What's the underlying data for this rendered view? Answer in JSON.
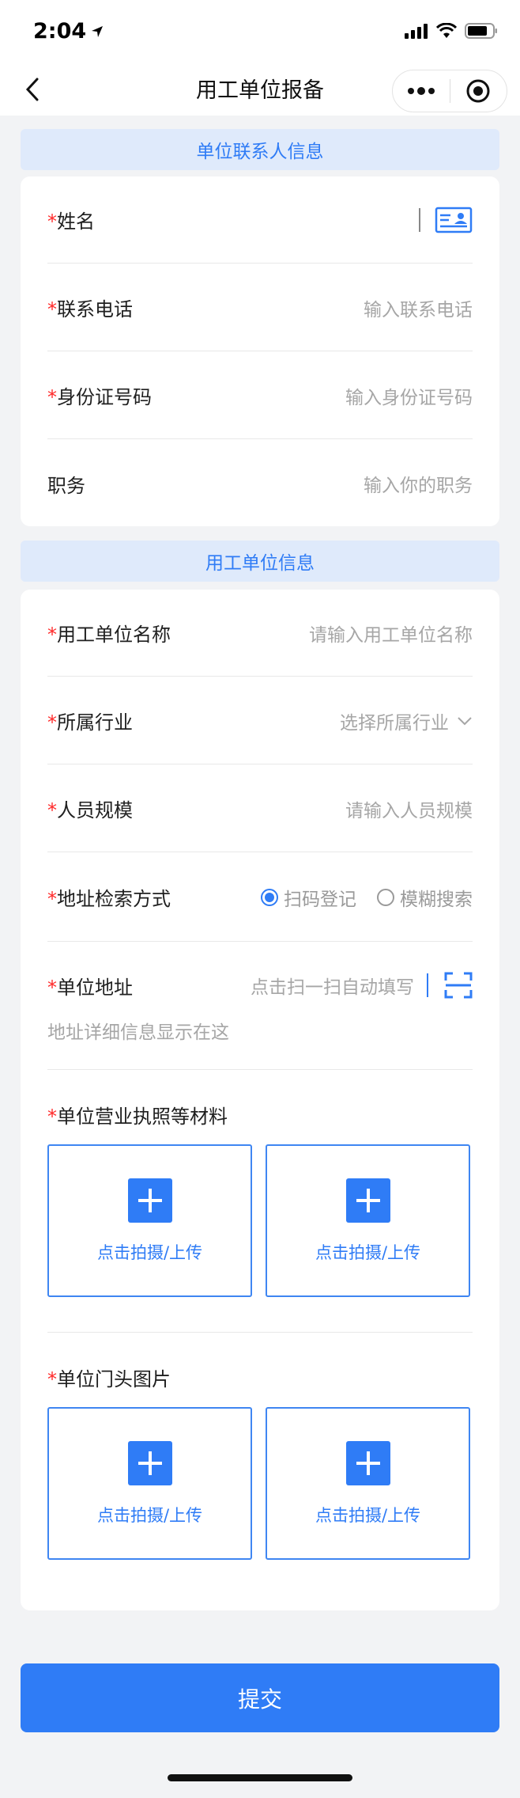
{
  "status_bar": {
    "time": "2:04"
  },
  "nav": {
    "title": "用工单位报备"
  },
  "contact_section": {
    "header": "单位联系人信息",
    "fields": [
      {
        "label": "姓名",
        "required": true,
        "placeholder": ""
      },
      {
        "label": "联系电话",
        "required": true,
        "placeholder": "输入联系电话"
      },
      {
        "label": "身份证号码",
        "required": true,
        "placeholder": "输入身份证号码"
      },
      {
        "label": "职务",
        "required": false,
        "placeholder": "输入你的职务"
      }
    ]
  },
  "unit_section": {
    "header": "用工单位信息",
    "name": {
      "label": "用工单位名称",
      "placeholder": "请输入用工单位名称"
    },
    "industry": {
      "label": "所属行业",
      "placeholder": "选择所属行业"
    },
    "scale": {
      "label": "人员规模",
      "placeholder": "请输入人员规模"
    },
    "search_mode": {
      "label": "地址检索方式",
      "options": [
        "扫码登记",
        "模糊搜索"
      ],
      "selected": "扫码登记"
    },
    "address": {
      "label": "单位地址",
      "placeholder": "点击扫一扫自动填写",
      "detail_placeholder": "地址详细信息显示在这"
    },
    "license": {
      "label": "单位营业执照等材料",
      "upload_label": "点击拍摄/上传"
    },
    "storefront": {
      "label": "单位门头图片",
      "upload_label": "点击拍摄/上传"
    }
  },
  "submit": {
    "label": "提交"
  },
  "colors": {
    "accent": "#2f7cf6",
    "required": "#ff2a2a",
    "section_bg": "#dfeafb"
  }
}
